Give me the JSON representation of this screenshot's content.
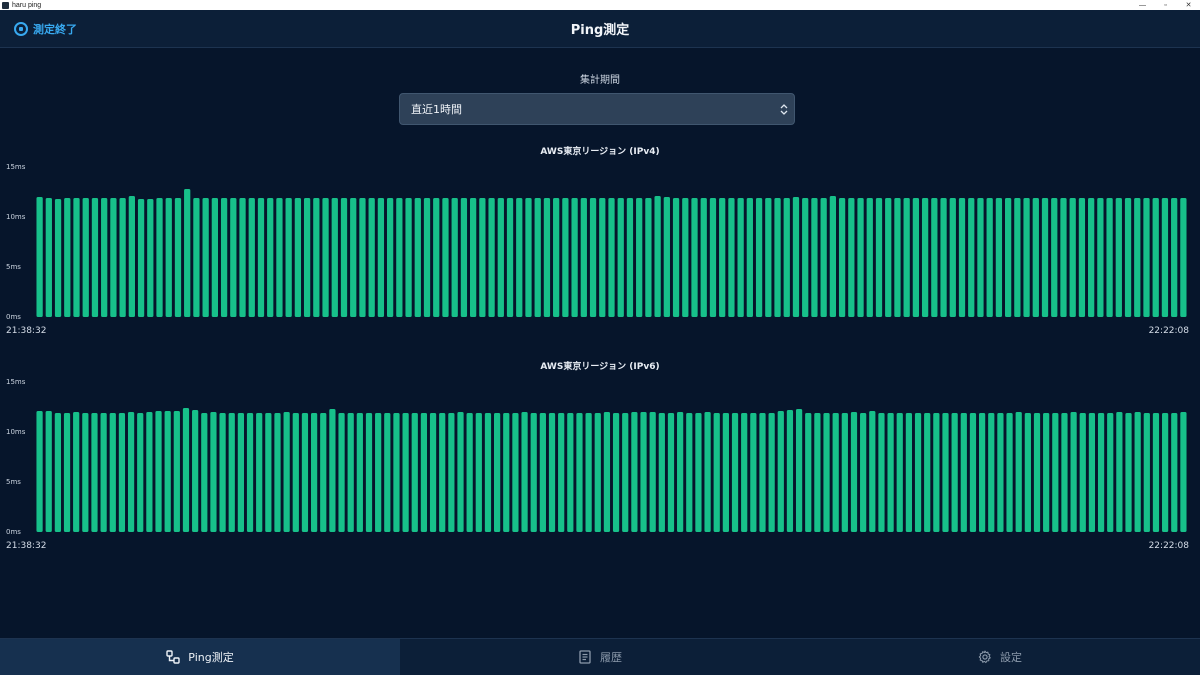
{
  "window": {
    "title": "haru ping",
    "controls": {
      "minimize": "—",
      "maximize": "▫",
      "close": "✕"
    }
  },
  "header": {
    "stop_label": "測定終了",
    "title": "Ping測定"
  },
  "period": {
    "label": "集計期間",
    "selected": "直近1時間"
  },
  "nav": {
    "items": [
      {
        "label": "Ping測定",
        "icon": "ping-icon",
        "active": true
      },
      {
        "label": "履歴",
        "icon": "history-icon",
        "active": false
      },
      {
        "label": "設定",
        "icon": "gear-icon",
        "active": false
      }
    ]
  },
  "colors": {
    "bar": "#17c08a",
    "background": "#06152b",
    "accent": "#38a9f0"
  },
  "chart_data": [
    {
      "type": "bar",
      "title": "AWS東京リージョン (IPv4)",
      "ylabel": "",
      "y_ticks": [
        "0ms",
        "5ms",
        "10ms",
        "15ms"
      ],
      "ylim": [
        0,
        15
      ],
      "x_start": "21:38:32",
      "x_end": "22:22:08",
      "values": [
        12.0,
        11.9,
        11.8,
        11.9,
        11.9,
        11.9,
        11.9,
        11.9,
        11.9,
        11.9,
        12.1,
        11.8,
        11.8,
        11.9,
        11.9,
        11.9,
        12.8,
        11.9,
        11.9,
        11.9,
        11.9,
        11.9,
        11.9,
        11.9,
        11.9,
        11.9,
        11.9,
        11.9,
        11.9,
        11.9,
        11.9,
        11.9,
        11.9,
        11.9,
        11.9,
        11.9,
        11.9,
        11.9,
        11.9,
        11.9,
        11.9,
        11.9,
        11.9,
        11.9,
        11.9,
        11.9,
        11.9,
        11.9,
        11.9,
        11.9,
        11.9,
        11.9,
        11.9,
        11.9,
        11.9,
        11.9,
        11.9,
        11.9,
        11.9,
        11.9,
        11.9,
        11.9,
        11.9,
        11.9,
        11.9,
        11.9,
        11.9,
        12.1,
        12.0,
        11.9,
        11.9,
        11.9,
        11.9,
        11.9,
        11.9,
        11.9,
        11.9,
        11.9,
        11.9,
        11.9,
        11.9,
        11.9,
        12.0,
        11.9,
        11.9,
        11.9,
        12.1,
        11.9,
        11.9,
        11.9,
        11.9,
        11.9,
        11.9,
        11.9,
        11.9,
        11.9,
        11.9,
        11.9,
        11.9,
        11.9,
        11.9,
        11.9,
        11.9,
        11.9,
        11.9,
        11.9,
        11.9,
        11.9,
        11.9,
        11.9,
        11.9,
        11.9,
        11.9,
        11.9,
        11.9,
        11.9,
        11.9,
        11.9,
        11.9,
        11.9,
        11.9,
        11.9,
        11.9,
        11.9,
        11.9
      ]
    },
    {
      "type": "bar",
      "title": "AWS東京リージョン (IPv6)",
      "ylabel": "",
      "y_ticks": [
        "0ms",
        "5ms",
        "10ms",
        "15ms"
      ],
      "ylim": [
        0,
        15
      ],
      "x_start": "21:38:32",
      "x_end": "22:22:08",
      "values": [
        12.1,
        12.1,
        11.9,
        11.9,
        12.0,
        11.9,
        11.9,
        11.9,
        11.9,
        11.9,
        12.0,
        11.9,
        12.0,
        12.1,
        12.1,
        12.1,
        12.4,
        12.2,
        11.9,
        12.0,
        11.9,
        11.9,
        11.9,
        11.9,
        11.9,
        11.9,
        11.9,
        12.0,
        11.9,
        11.9,
        11.9,
        11.9,
        12.3,
        11.9,
        11.9,
        11.9,
        11.9,
        11.9,
        11.9,
        11.9,
        11.9,
        11.9,
        11.9,
        11.9,
        11.9,
        11.9,
        12.0,
        11.9,
        11.9,
        11.9,
        11.9,
        11.9,
        11.9,
        12.0,
        11.9,
        11.9,
        11.9,
        11.9,
        11.9,
        11.9,
        11.9,
        11.9,
        12.0,
        11.9,
        11.9,
        12.0,
        12.0,
        12.0,
        11.9,
        11.9,
        12.0,
        11.9,
        11.9,
        12.0,
        11.9,
        11.9,
        11.9,
        11.9,
        11.9,
        11.9,
        11.9,
        12.1,
        12.2,
        12.3,
        11.9,
        11.9,
        11.9,
        11.9,
        11.9,
        12.0,
        11.9,
        12.1,
        11.9,
        11.9,
        11.9,
        11.9,
        11.9,
        11.9,
        11.9,
        11.9,
        11.9,
        11.9,
        11.9,
        11.9,
        11.9,
        11.9,
        11.9,
        12.0,
        11.9,
        11.9,
        11.9,
        11.9,
        11.9,
        12.0,
        11.9,
        11.9,
        11.9,
        11.9,
        12.0,
        11.9,
        12.0,
        11.9,
        11.9,
        11.9,
        11.9,
        12.0
      ]
    }
  ]
}
